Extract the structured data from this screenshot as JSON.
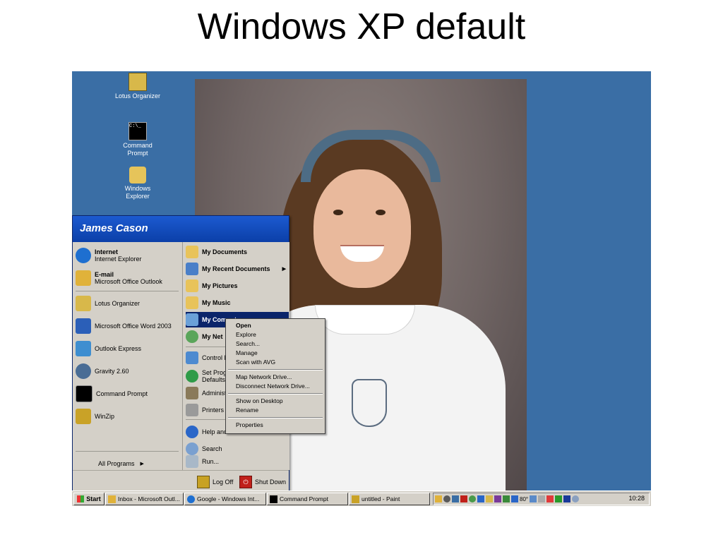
{
  "slide": {
    "title": "Windows XP default"
  },
  "desktop": {
    "icons": [
      {
        "label": "Lotus Organizer",
        "icon": "lotus-organizer-icon"
      },
      {
        "label_line1": "Command",
        "label_line2": "Prompt",
        "icon": "command-prompt-icon"
      },
      {
        "label_line1": "Windows",
        "label_line2": "Explorer",
        "icon": "windows-explorer-icon"
      }
    ]
  },
  "start_menu": {
    "user_name": "James Cason",
    "pinned": [
      {
        "title": "Internet",
        "subtitle": "Internet Explorer",
        "color": "#1e6fd0"
      },
      {
        "title": "E-mail",
        "subtitle": "Microsoft Office Outlook",
        "color": "#e0b23a"
      }
    ],
    "recent": [
      {
        "label": "Lotus Organizer",
        "color": "#d8b84a"
      },
      {
        "label": "Microsoft Office Word 2003",
        "color": "#2b5fb8"
      },
      {
        "label": "Outlook Express",
        "color": "#3e8ed0"
      },
      {
        "label": "Gravity 2.60",
        "color": "#4a6d95"
      },
      {
        "label": "Command Prompt",
        "color": "#000000"
      },
      {
        "label": "WinZip",
        "color": "#c9a227"
      }
    ],
    "all_programs": "All Programs",
    "right_items": [
      {
        "label": "My Documents",
        "bold": true,
        "color": "#e8c35a"
      },
      {
        "label": "My Recent Documents",
        "bold": true,
        "color": "#4a7fc8",
        "arrow": "▶"
      },
      {
        "label": "My Pictures",
        "bold": true,
        "color": "#e8c35a"
      },
      {
        "label": "My Music",
        "bold": true,
        "color": "#e8c35a"
      },
      {
        "label": "My Computer",
        "bold": true,
        "color": "#6aa0d8",
        "highlighted": true
      },
      {
        "label": "My Net",
        "bold": true,
        "color": "#5aa55a"
      },
      {
        "label": "Control F",
        "bold": false,
        "color": "#4d8ad0"
      },
      {
        "label": "Set Prog",
        "label2": "Defaults",
        "bold": false,
        "color": "#2f9b48"
      },
      {
        "label": "Administ",
        "bold": false,
        "color": "#8a7a5a"
      },
      {
        "label": "Printers",
        "bold": false,
        "color": "#9a9a9a"
      },
      {
        "label": "Help and",
        "bold": false,
        "color": "#2a66c8"
      },
      {
        "label": "Search",
        "bold": false,
        "color": "#7aa0d0"
      },
      {
        "label": "Run...",
        "bold": false,
        "color": "#a8b8c8"
      }
    ],
    "log_off": "Log Off",
    "shut_down": "Shut Down"
  },
  "context_menu": {
    "group1": [
      "Open",
      "Explore",
      "Search...",
      "Manage",
      "Scan with AVG"
    ],
    "group2": [
      "Map Network Drive...",
      "Disconnect Network Drive..."
    ],
    "group3": [
      "Show on Desktop",
      "Rename"
    ],
    "group4": [
      "Properties"
    ]
  },
  "taskbar": {
    "start_label": "Start",
    "buttons": [
      {
        "label": "Inbox - Microsoft Outl...",
        "icon": "outlook-icon"
      },
      {
        "label": "Google - Windows Int...",
        "icon": "ie-icon"
      },
      {
        "label": "Command Prompt",
        "icon": "cmd-icon"
      },
      {
        "label": "untitled - Paint",
        "icon": "paint-icon"
      }
    ],
    "clock": "10:28",
    "temperature": "80°"
  },
  "colors": {
    "desktop": "#3a6ea5",
    "menu_header": "#1c5ad0",
    "menu_bg": "#d4d0c8",
    "highlight": "#0a246a"
  }
}
